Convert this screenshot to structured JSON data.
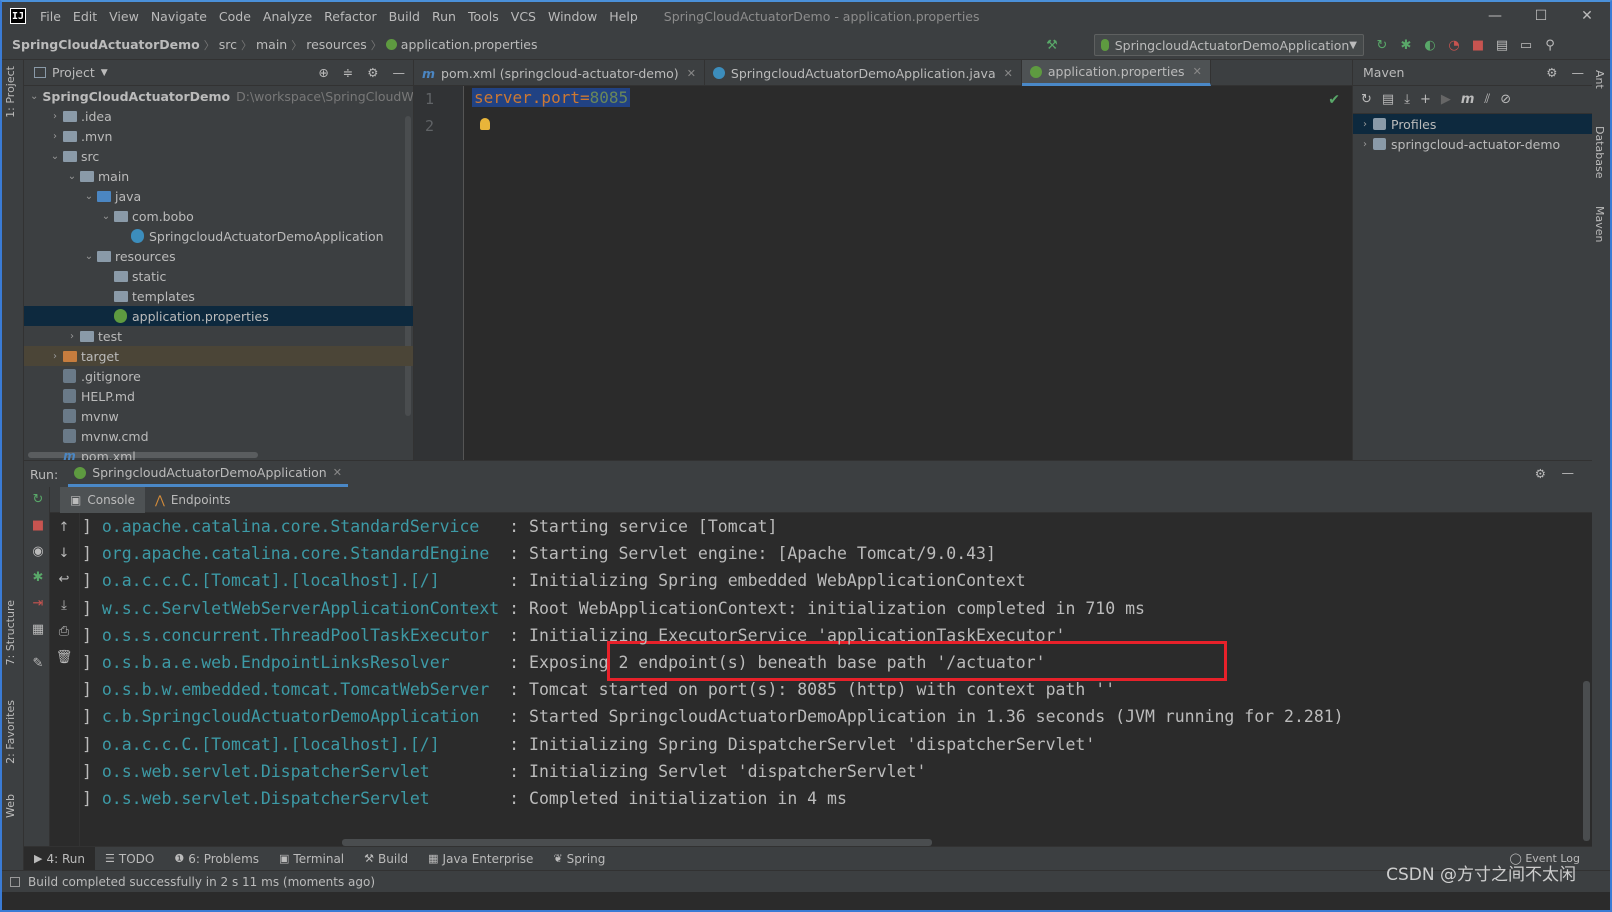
{
  "menu": [
    "File",
    "Edit",
    "View",
    "Navigate",
    "Code",
    "Analyze",
    "Refactor",
    "Build",
    "Run",
    "Tools",
    "VCS",
    "Window",
    "Help"
  ],
  "window_title": "SpringCloudActuatorDemo - application.properties",
  "window_controls": {
    "minimize": "—",
    "maximize": "☐",
    "close": "✕"
  },
  "breadcrumb": [
    "SpringCloudActuatorDemo",
    "src",
    "main",
    "resources",
    "application.properties"
  ],
  "run_config": "SpringcloudActuatorDemoApplication",
  "project_panel": {
    "title": "Project",
    "tree": [
      {
        "label": "SpringCloudActuatorDemo",
        "hint": "D:\\workspace\\SpringCloudWo",
        "depth": 0,
        "arrow": "open",
        "icon": "folder",
        "bold": true
      },
      {
        "label": ".idea",
        "depth": 1,
        "arrow": "closed",
        "icon": "folder"
      },
      {
        "label": ".mvn",
        "depth": 1,
        "arrow": "closed",
        "icon": "folder"
      },
      {
        "label": "src",
        "depth": 1,
        "arrow": "open",
        "icon": "folder"
      },
      {
        "label": "main",
        "depth": 2,
        "arrow": "open",
        "icon": "folder"
      },
      {
        "label": "java",
        "depth": 3,
        "arrow": "open",
        "icon": "folder-blue"
      },
      {
        "label": "com.bobo",
        "depth": 4,
        "arrow": "open",
        "icon": "folder"
      },
      {
        "label": "SpringcloudActuatorDemoApplication",
        "depth": 5,
        "arrow": "none",
        "icon": "java"
      },
      {
        "label": "resources",
        "depth": 3,
        "arrow": "open",
        "icon": "folder"
      },
      {
        "label": "static",
        "depth": 4,
        "arrow": "none",
        "icon": "folder"
      },
      {
        "label": "templates",
        "depth": 4,
        "arrow": "none",
        "icon": "folder"
      },
      {
        "label": "application.properties",
        "depth": 4,
        "arrow": "none",
        "icon": "spring",
        "selected": true
      },
      {
        "label": "test",
        "depth": 2,
        "arrow": "closed",
        "icon": "folder"
      },
      {
        "label": "target",
        "depth": 1,
        "arrow": "closed",
        "icon": "folder-orange",
        "target": true
      },
      {
        "label": ".gitignore",
        "depth": 1,
        "arrow": "none",
        "icon": "file"
      },
      {
        "label": "HELP.md",
        "depth": 1,
        "arrow": "none",
        "icon": "file"
      },
      {
        "label": "mvnw",
        "depth": 1,
        "arrow": "none",
        "icon": "file"
      },
      {
        "label": "mvnw.cmd",
        "depth": 1,
        "arrow": "none",
        "icon": "file"
      },
      {
        "label": "pom.xml",
        "depth": 1,
        "arrow": "none",
        "icon": "m"
      }
    ]
  },
  "editor": {
    "tabs": [
      {
        "label": "pom.xml (springcloud-actuator-demo)",
        "icon": "m",
        "active": false
      },
      {
        "label": "SpringcloudActuatorDemoApplication.java",
        "icon": "java",
        "active": false
      },
      {
        "label": "application.properties",
        "icon": "spring",
        "active": true
      }
    ],
    "line_numbers": [
      "1",
      "2"
    ],
    "code_key": "server.port",
    "code_eq": "=",
    "code_value": "8085"
  },
  "maven": {
    "title": "Maven",
    "items": [
      {
        "label": "Profiles",
        "selected": true
      },
      {
        "label": "springcloud-actuator-demo",
        "selected": false
      }
    ]
  },
  "run": {
    "label": "Run:",
    "tab": "SpringcloudActuatorDemoApplication",
    "subtabs": [
      "Console",
      "Endpoints"
    ],
    "log": [
      {
        "logger": "o.apache.catalina.core.StandardService   ",
        "msg": ": Starting service [Tomcat]"
      },
      {
        "logger": "org.apache.catalina.core.StandardEngine  ",
        "msg": ": Starting Servlet engine: [Apache Tomcat/9.0.43]"
      },
      {
        "logger": "o.a.c.c.C.[Tomcat].[localhost].[/]       ",
        "msg": ": Initializing Spring embedded WebApplicationContext"
      },
      {
        "logger": "w.s.c.ServletWebServerApplicationContext ",
        "msg": ": Root WebApplicationContext: initialization completed in 710 ms"
      },
      {
        "logger": "o.s.s.concurrent.ThreadPoolTaskExecutor  ",
        "msg": ": Initializing ExecutorService 'applicationTaskExecutor'"
      },
      {
        "logger": "o.s.b.a.e.web.EndpointLinksResolver      ",
        "msg": ": Exposing 2 endpoint(s) beneath base path '/actuator'"
      },
      {
        "logger": "o.s.b.w.embedded.tomcat.TomcatWebServer  ",
        "msg": ": Tomcat started on port(s): 8085 (http) with context path ''"
      },
      {
        "logger": "c.b.SpringcloudActuatorDemoApplication   ",
        "msg": ": Started SpringcloudActuatorDemoApplication in 1.36 seconds (JVM running for 2.281)"
      },
      {
        "logger": "o.a.c.c.C.[Tomcat].[localhost].[/]       ",
        "msg": ": Initializing Spring DispatcherServlet 'dispatcherServlet'"
      },
      {
        "logger": "o.s.web.servlet.DispatcherServlet        ",
        "msg": ": Initializing Servlet 'dispatcherServlet'"
      },
      {
        "logger": "o.s.web.servlet.DispatcherServlet        ",
        "msg": ": Completed initialization in 4 ms"
      }
    ]
  },
  "bottom_tabs": [
    {
      "label": "4: Run",
      "icon": "▶",
      "active": true
    },
    {
      "label": "TODO",
      "icon": "☰",
      "active": false
    },
    {
      "label": "6: Problems",
      "icon": "❶",
      "active": false
    },
    {
      "label": "Terminal",
      "icon": "▣",
      "active": false
    },
    {
      "label": "Build",
      "icon": "⚒",
      "active": false
    },
    {
      "label": "Java Enterprise",
      "icon": "▦",
      "active": false
    },
    {
      "label": "Spring",
      "icon": "❦",
      "active": false
    }
  ],
  "left_vtabs": [
    "1: Project",
    "7: Structure",
    "2: Favorites",
    "Web"
  ],
  "right_vtabs": [
    "Ant",
    "Database",
    "Maven"
  ],
  "status": "Build completed successfully in 2 s 11 ms (moments ago)",
  "event_log": "Event Log",
  "watermark": "CSDN @方寸之间不太闲",
  "colors": {
    "accent": "#4a88c7",
    "highlight_box": "#e8212a",
    "logger": "#3d9aa6"
  }
}
